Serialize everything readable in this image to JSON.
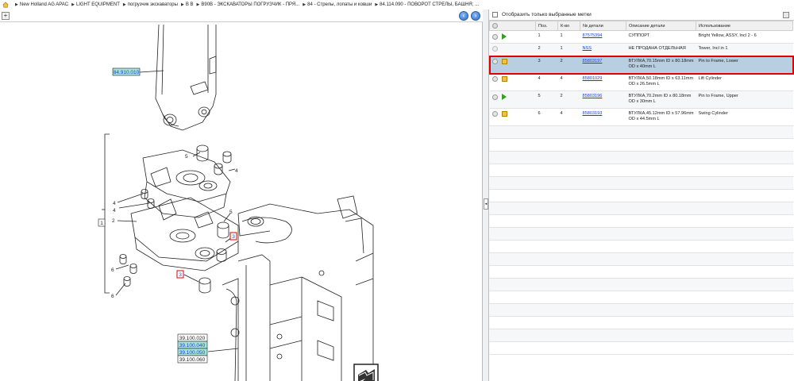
{
  "breadcrumb": [
    "New Holland AG APAC",
    "LIGHT EQUIPMENT",
    "погрузчик экскаваторы",
    "B B",
    "B90B - ЭКСКАВАТОРЫ ПОГРУЗЧИК - ПРЯ...",
    "84 - Стрелы, лопаты и ковши",
    "84.114.090 - ПОВОРОТ СТРЕЛЫ, БАШНЯ; ..."
  ],
  "filter": {
    "label": "Отобразить только выбранные метки",
    "checked": false
  },
  "table": {
    "headers": [
      "",
      "Поз.",
      "К-во",
      "№ детали",
      "Описание детали",
      "Использование"
    ],
    "rows": [
      {
        "pos": "1",
        "qty": "1",
        "part": "87575394",
        "desc": "СУППОРТ",
        "usage": "Bright Yellow, ASSY, Incl 2 - 6",
        "icon": "green-arrow-icon",
        "selected": false
      },
      {
        "pos": "2",
        "qty": "1",
        "part": "NSS",
        "desc": "НЕ ПРОДАНА ОТДЕЛЬНАЯ",
        "usage": "Tower, Incl in 1",
        "icon": "",
        "selected": false
      },
      {
        "pos": "3",
        "qty": "2",
        "part": "85803197",
        "desc": "ВТУЛКА,70.15mm ID x 80.18mm OD x 40mm L",
        "usage": "Pin to Frame, Lower",
        "icon": "yellow-box-icon",
        "selected": true
      },
      {
        "pos": "4",
        "qty": "4",
        "part": "85801029",
        "desc": "ВТУЛКА,50.18mm ID x 63.11mm OD x 26.5mm L",
        "usage": "Lift Cylinder",
        "icon": "yellow-box-icon",
        "selected": false
      },
      {
        "pos": "5",
        "qty": "2",
        "part": "85803196",
        "desc": "ВТУЛКА,70.2mm ID x 80.18mm OD x 30mm L",
        "usage": "Pin to Frame, Upper",
        "icon": "green-arrow-icon",
        "selected": false
      },
      {
        "pos": "6",
        "qty": "4",
        "part": "85803193",
        "desc": "ВТУЛКА,45.12mm ID x 57.96mm OD x 44.5mm L",
        "usage": "Swing Cylinder",
        "icon": "yellow-box-icon",
        "selected": false
      }
    ]
  },
  "drawing": {
    "refs_top": "84.910.010",
    "refs_bottom": [
      "39.100.020",
      "39.100.040",
      "39.100.050",
      "39.100.060"
    ],
    "highlighted_refs": [
      "84.910.010",
      "39.100.040",
      "39.100.050"
    ],
    "callouts": [
      "1",
      "2",
      "3",
      "3",
      "4",
      "4",
      "4",
      "5",
      "5",
      "6",
      "6"
    ],
    "selected_callout": "3"
  },
  "colors": {
    "selection_outline": "#e00000",
    "selected_row": "#b7cfe1",
    "ref_highlight": "#a6e3d8",
    "link": "#1a3fd6"
  }
}
